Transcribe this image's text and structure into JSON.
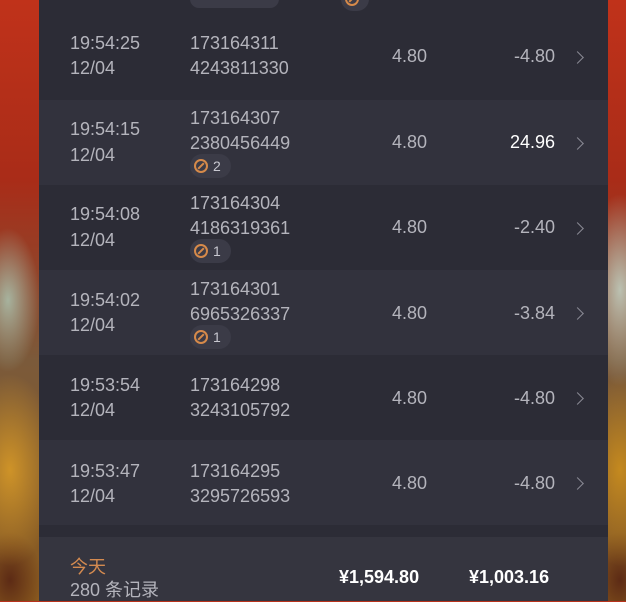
{
  "rows": [
    {
      "time": "19:54:25",
      "date": "12/04",
      "order_a": "173164311",
      "order_b": "4243811330",
      "amount": "4.80",
      "delta": "-4.80",
      "badge": ""
    },
    {
      "time": "19:54:15",
      "date": "12/04",
      "order_a": "173164307",
      "order_b": "2380456449",
      "amount": "4.80",
      "delta": "24.96",
      "badge": "2"
    },
    {
      "time": "19:54:08",
      "date": "12/04",
      "order_a": "173164304",
      "order_b": "4186319361",
      "amount": "4.80",
      "delta": "-2.40",
      "badge": "1"
    },
    {
      "time": "19:54:02",
      "date": "12/04",
      "order_a": "173164301",
      "order_b": "6965326337",
      "amount": "4.80",
      "delta": "-3.84",
      "badge": "1"
    },
    {
      "time": "19:53:54",
      "date": "12/04",
      "order_a": "173164298",
      "order_b": "3243105792",
      "amount": "4.80",
      "delta": "-4.80",
      "badge": ""
    },
    {
      "time": "19:53:47",
      "date": "12/04",
      "order_a": "173164295",
      "order_b": "3295726593",
      "amount": "4.80",
      "delta": "-4.80",
      "badge": ""
    }
  ],
  "footer": {
    "today_label": "今天",
    "record_count": "280 条记录",
    "total_amount": "¥1,594.80",
    "total_delta": "¥1,003.16"
  },
  "colors": {
    "accent": "#d38a50",
    "panel": "#2c2c36",
    "row_alt": "#32323d"
  }
}
